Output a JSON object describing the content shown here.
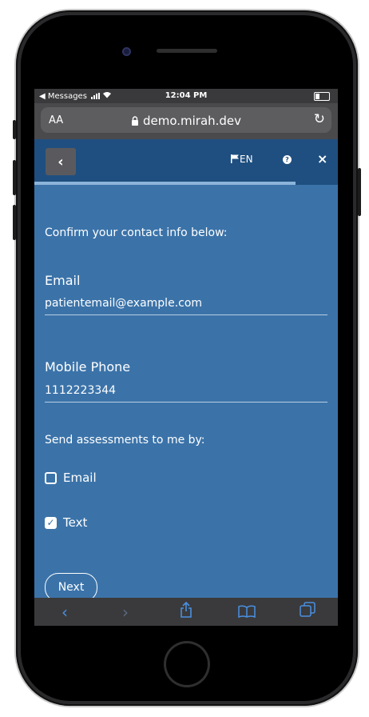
{
  "status_bar": {
    "back_app": "◀ Messages",
    "time": "12:04 PM"
  },
  "browser": {
    "text_size": "AA",
    "url": "demo.mirah.dev",
    "lock_icon": "lock-icon",
    "reload_icon": "reload-icon"
  },
  "header": {
    "back_icon": "chevron-left-icon",
    "language": "EN",
    "help_icon": "question-icon",
    "close_icon": "close-icon",
    "progress": 0.86
  },
  "form": {
    "intro": "Confirm your contact info below:",
    "email_label": "Email",
    "email_value": "patientemail@example.com",
    "phone_label": "Mobile Phone",
    "phone_value": "1112223344",
    "send_label": "Send assessments to me by:",
    "options": [
      {
        "label": "Email",
        "checked": false
      },
      {
        "label": "Text",
        "checked": true
      }
    ],
    "next_label": "Next"
  },
  "toolbar": {
    "icons": [
      "back-icon",
      "forward-icon",
      "share-icon",
      "bookmarks-icon",
      "tabs-icon"
    ]
  },
  "colors": {
    "screen_bg": "#3b73a9",
    "header_bg": "#1f4f80",
    "progress": "#8cb4da",
    "toolbar_accent": "#4a90e2"
  }
}
